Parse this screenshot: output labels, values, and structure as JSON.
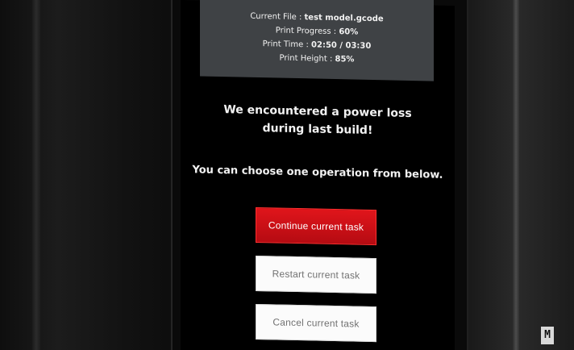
{
  "status": {
    "current_file_label": "Current File :",
    "current_file_value": "test model.gcode",
    "print_progress_label": "Print Progress :",
    "print_progress_value": "60%",
    "print_time_label": "Print Time :",
    "print_time_value": "02:50 / 03:30",
    "print_height_label": "Print Height :",
    "print_height_value": "85%"
  },
  "message": {
    "line1": "We encountered a power loss",
    "line2": "during last build!",
    "instruction": "You can choose one operation from below."
  },
  "buttons": {
    "continue": "Continue current task",
    "restart": "Restart current task",
    "cancel": "Cancel current task"
  },
  "branding": {
    "logo_text": "M"
  },
  "colors": {
    "primary": "#d5121a",
    "panel": "#3f4245",
    "screen": "#000000"
  }
}
